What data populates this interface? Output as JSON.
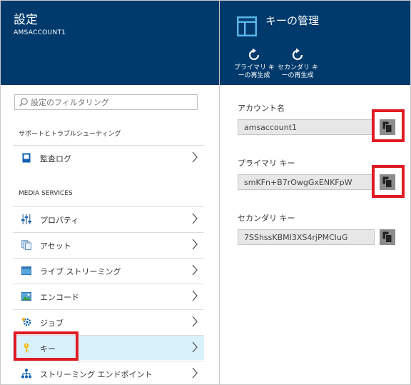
{
  "settings": {
    "title": "設定",
    "account": "AMSACCOUNT1",
    "search": {
      "placeholder": "設定のフィルタリング"
    },
    "support_section": "サポートとトラブルシューティング",
    "audit_item": "監査ログ",
    "media_section": "MEDIA SERVICES",
    "items": [
      {
        "label": "プロパティ"
      },
      {
        "label": "アセット"
      },
      {
        "label": "ライブ ストリーミング"
      },
      {
        "label": "エンコード"
      },
      {
        "label": "ジョブ"
      },
      {
        "label": "キー"
      },
      {
        "label": "ストリーミング エンドポイント"
      }
    ]
  },
  "keys": {
    "title": "キーの管理",
    "regen_primary": "プライマリ キ\nーの再生成",
    "regen_secondary": "セカンダリ キ\nーの再生成",
    "fields": [
      {
        "label": "アカウント名",
        "value": "amsaccount1"
      },
      {
        "label": "プライマリ キー",
        "value": "smKFn+B7rOwgGxENKFpW"
      },
      {
        "label": "セカンダリ キー",
        "value": "7SShssKBMI3XS4rjPMCluG"
      }
    ]
  },
  "colors": {
    "header_bg": "#003a6c",
    "selected_bg": "#d9f1fb",
    "highlight": "#e01a22"
  },
  "icons": [
    "search-icon",
    "book-icon",
    "chevron-right-icon",
    "properties-icon",
    "assets-icon",
    "live-streaming-icon",
    "encode-icon",
    "job-gear-icon",
    "key-icon",
    "endpoint-icon",
    "blade-icon",
    "refresh-icon",
    "copy-icon"
  ]
}
